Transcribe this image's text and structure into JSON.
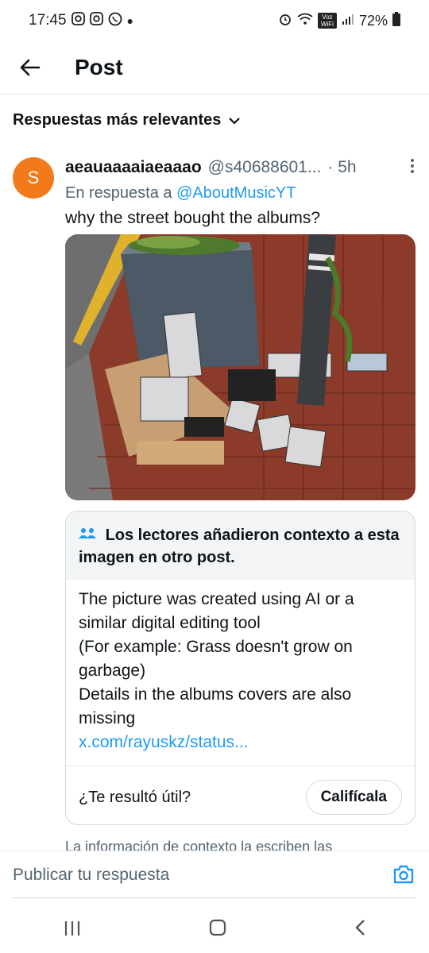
{
  "status_bar": {
    "time": "17:45",
    "left_icons": [
      "instagram-icon",
      "instagram-icon",
      "whatsapp-icon",
      "dot-icon"
    ],
    "right_icons": [
      "alarm-icon",
      "wifi-icon",
      "volte-icon",
      "signal-icon",
      "battery-icon"
    ],
    "volte_label": "Voz WiFi",
    "battery": "72%"
  },
  "header": {
    "back_icon": "arrow-left-icon",
    "title": "Post"
  },
  "sort": {
    "label": "Respuestas más relevantes",
    "icon": "chevron-down-icon"
  },
  "tweet": {
    "avatar_letter": "S",
    "avatar_color": "#f27a1a",
    "name": "aeauaaaaiaeaaao",
    "handle": "@s40688601...",
    "time": "· 5h",
    "more_icon": "more-vertical-icon",
    "reply_prefix": "En respuesta a",
    "reply_to": "@AboutMusicYT",
    "text": "why the street bought the albums?",
    "image_alt": "photo of album CDs piled on a sidewalk next to a trash bin"
  },
  "note": {
    "header_icon": "people-icon",
    "header": "Los lectores añadieron contexto a esta imagen en otro post.",
    "lines": [
      "The picture was created using AI or a",
      "similar digital editing tool",
      "(For example: Grass doesn't grow on",
      "garbage)",
      "Details in the albums covers are also",
      "missing"
    ],
    "link": "x.com/rayuskz/status...",
    "question": "¿Te resultó útil?",
    "rate_button": "Califícala"
  },
  "context_info": "La información de contexto la escriben las",
  "reply_bar": {
    "placeholder": "Publicar tu respuesta",
    "camera_icon": "camera-icon"
  },
  "nav": {
    "icons": [
      "recent-apps-icon",
      "home-icon",
      "back-icon"
    ]
  },
  "colors": {
    "accent": "#1d9bf0",
    "secondary_text": "#536471"
  }
}
